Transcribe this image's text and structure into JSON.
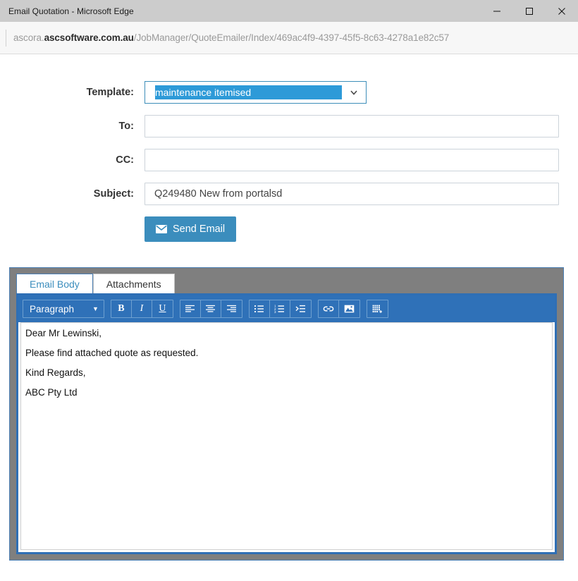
{
  "window": {
    "title": "Email Quotation - Microsoft Edge",
    "minimize_label": "Minimize",
    "maximize_label": "Maximize",
    "close_label": "Close"
  },
  "address_bar": {
    "url_host_prefix": "ascora.",
    "url_host_strong": "ascsoftware.com.au",
    "url_path": "/JobManager/QuoteEmailer/Index/469ac4f9-4397-45f5-8c63-4278a1e82c57",
    "full_url": "ascora.ascsoftware.com.au/JobManager/QuoteEmailer/Index/469ac4f9-4397-45f5-8c63-4278a1e82c57"
  },
  "form": {
    "template": {
      "label": "Template:",
      "value": "maintenance itemised",
      "arrow_icon": "chevron-down-icon"
    },
    "to": {
      "label": "To:",
      "value": "",
      "placeholder": ""
    },
    "cc": {
      "label": "CC:",
      "value": "",
      "placeholder": ""
    },
    "subject": {
      "label": "Subject:",
      "value": "Q249480 New from portalsd",
      "placeholder": ""
    },
    "send_button": {
      "label": "Send Email",
      "icon": "envelope-icon"
    }
  },
  "panel": {
    "tabs": [
      {
        "label": "Email Body",
        "active": true
      },
      {
        "label": "Attachments",
        "active": false
      }
    ],
    "editor": {
      "toolbar": {
        "paragraph_label": "Paragraph",
        "paragraph_caret": "▼",
        "bold_label": "B",
        "italic_label": "I",
        "underline_label": "U",
        "align_left_label": "Align left",
        "align_center_label": "Align center",
        "align_right_label": "Align right",
        "bullet_list_label": "Bulleted list",
        "numbered_list_label": "Numbered list",
        "indent_label": "Increase indent",
        "link_label": "Insert link",
        "image_label": "Insert image",
        "table_label": "Insert table"
      },
      "body_paragraphs": [
        "Dear Mr Lewinski,",
        "Please find attached quote as requested.",
        "Kind Regards,",
        "ABC Pty Ltd"
      ]
    }
  },
  "colors": {
    "titlebar": "#cccccc",
    "accent_blue": "#3b8dbd",
    "selection_blue": "#2d9ad8",
    "toolbar_blue": "#2f71b8",
    "panel_gray": "#7f7f7f",
    "editor_border": "#2f6fb5"
  }
}
